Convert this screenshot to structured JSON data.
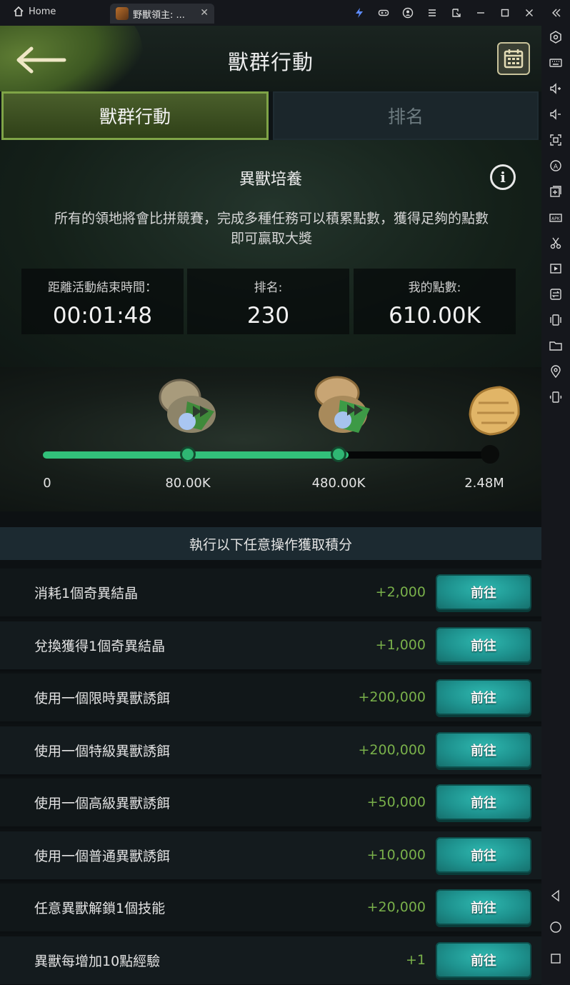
{
  "titlebar": {
    "home_label": "Home",
    "app_tab_label": "野獸領主: ...",
    "icons": [
      "bolt-icon",
      "gamepad-icon",
      "account-icon",
      "menu-icon",
      "external-icon",
      "minimize-icon",
      "maximize-icon",
      "close-icon",
      "collapse-icon"
    ]
  },
  "sidebar": {
    "icons": [
      "settings-icon",
      "keyboard-icon",
      "volume-up-icon",
      "volume-down-icon",
      "screenshot-icon",
      "rotate-icon",
      "add-app-icon",
      "apk-icon",
      "scissors-icon",
      "record-icon",
      "sync-icon",
      "shake-icon",
      "folder-icon",
      "location-icon",
      "device-icon",
      "back-nav-icon",
      "home-nav-icon",
      "recents-nav-icon"
    ]
  },
  "header": {
    "title": "獸群行動"
  },
  "tabs": [
    {
      "label": "獸群行動",
      "active": true
    },
    {
      "label": "排名",
      "active": false
    }
  ],
  "event": {
    "title": "異獸培養",
    "description_line1": "所有的領地將會比拼競賽，完成多種任務可以積累點數，獲得足夠的點數",
    "description_line2": "即可贏取大獎",
    "info_glyph": "i"
  },
  "stats": {
    "time_label": "距離活動結束時間：",
    "time_value": "00:01:48",
    "rank_label": "排名:",
    "rank_value": "230",
    "points_label": "我的點數:",
    "points_value": "610.00K"
  },
  "progress": {
    "current": 610000,
    "max": 2480000,
    "milestones": [
      {
        "label": "0",
        "value": 0
      },
      {
        "label": "80.00K",
        "value": 80000
      },
      {
        "label": "480.00K",
        "value": 480000
      },
      {
        "label": "2.48M",
        "value": 2480000
      }
    ]
  },
  "tasks_header": "執行以下任意操作獲取積分",
  "tasks": [
    {
      "label": "消耗1個奇異結晶",
      "points": "+2,000",
      "button": "前往"
    },
    {
      "label": "兌換獲得1個奇異結晶",
      "points": "+1,000",
      "button": "前往"
    },
    {
      "label": "使用一個限時異獸誘餌",
      "points": "+200,000",
      "button": "前往"
    },
    {
      "label": "使用一個特級異獸誘餌",
      "points": "+200,000",
      "button": "前往"
    },
    {
      "label": "使用一個高級異獸誘餌",
      "points": "+50,000",
      "button": "前往"
    },
    {
      "label": "使用一個普通異獸誘餌",
      "points": "+10,000",
      "button": "前往"
    },
    {
      "label": "任意異獸解鎖1個技能",
      "points": "+20,000",
      "button": "前往"
    },
    {
      "label": "異獸每增加10點經驗",
      "points": "+1",
      "button": "前往"
    }
  ],
  "colors": {
    "accent_green": "#32c07a",
    "points_green": "#79b04a",
    "button_teal": "#1e938f"
  }
}
